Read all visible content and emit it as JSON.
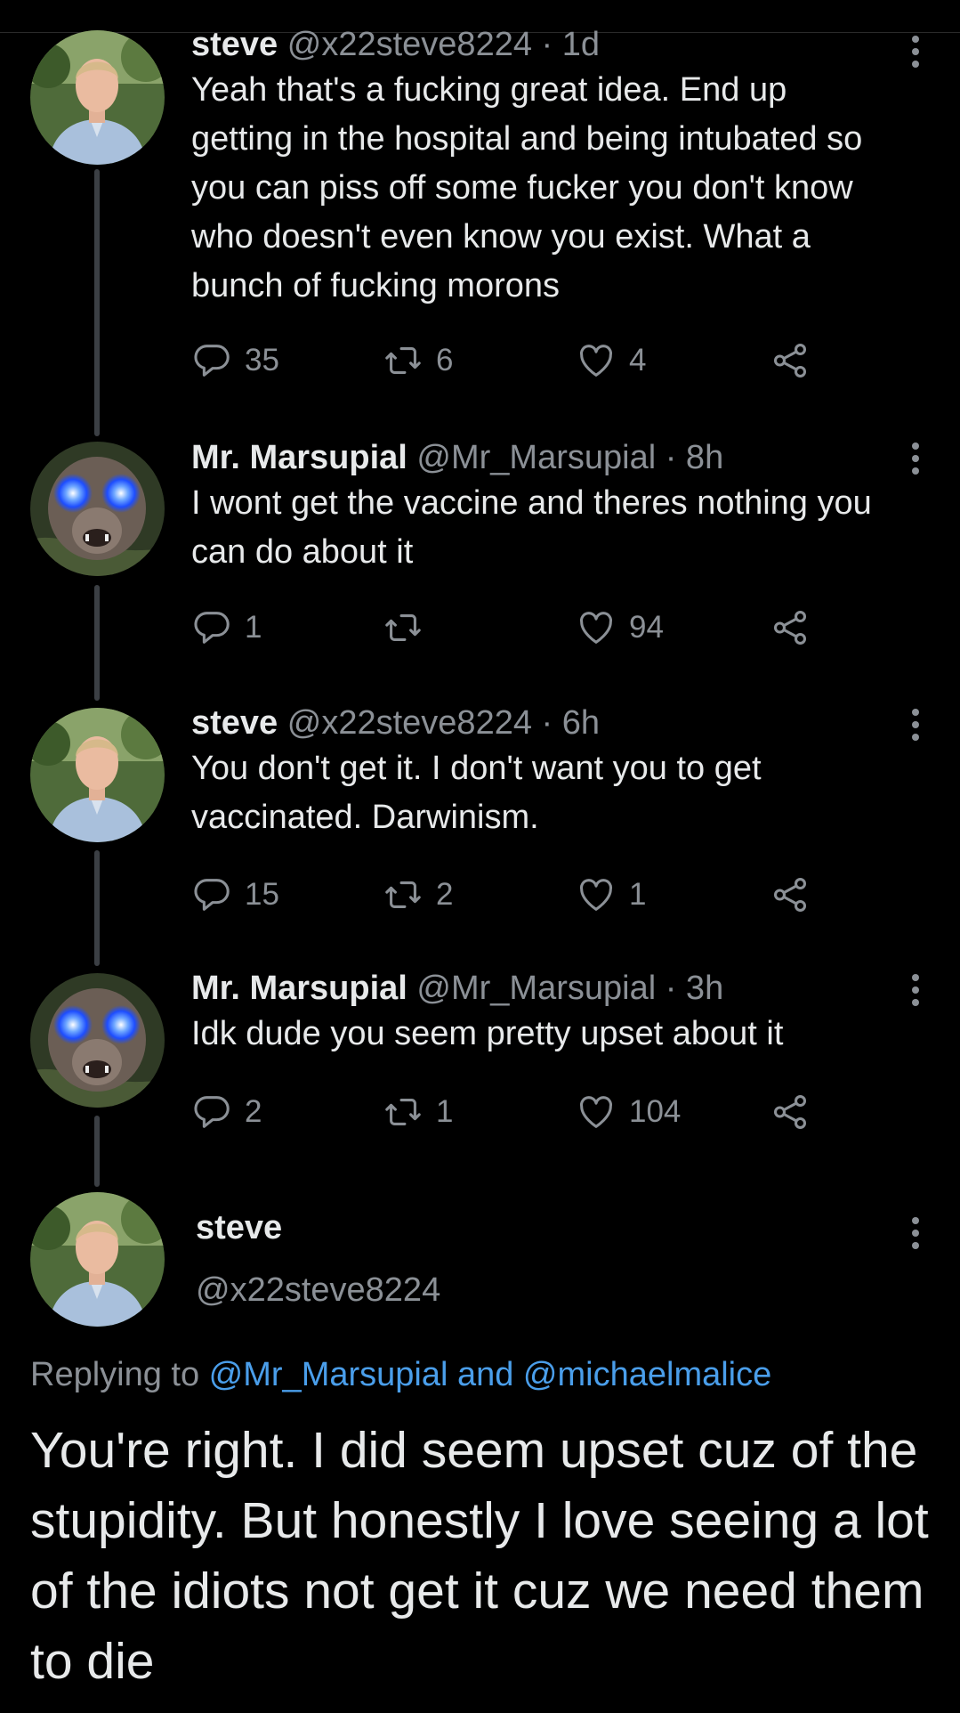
{
  "tweets": [
    {
      "name": "steve",
      "handle": "@x22steve8224",
      "time": "· 1d",
      "text": "Yeah that's a fucking great idea. End up getting in the hospital and being intubated so you can piss off some fucker you don't know who doesn't even know you exist. What a bunch of fucking morons",
      "replies": "35",
      "retweets": "6",
      "likes": "4",
      "avatar": "man-photo"
    },
    {
      "name": "Mr. Marsupial",
      "handle": "@Mr_Marsupial",
      "time": "· 8h",
      "text": "I wont get the vaccine and theres nothing you can do about it",
      "replies": "1",
      "retweets": "",
      "likes": "94",
      "avatar": "possum-glowing-eyes"
    },
    {
      "name": "steve",
      "handle": "@x22steve8224",
      "time": "· 6h",
      "text": "You don't get it. I don't want you to get vaccinated. Darwinism.",
      "replies": "15",
      "retweets": "2",
      "likes": "1",
      "avatar": "man-photo"
    },
    {
      "name": "Mr. Marsupial",
      "handle": "@Mr_Marsupial",
      "time": "· 3h",
      "text": "Idk dude you seem pretty upset about it",
      "replies": "2",
      "retweets": "1",
      "likes": "104",
      "avatar": "possum-glowing-eyes"
    }
  ],
  "focus": {
    "name": "steve",
    "handle": "@x22steve8224",
    "replying_prefix": "Replying to ",
    "replying_to": "@Mr_Marsupial and @michaelmalice",
    "text": "You're right. I did seem upset cuz of the stupidity. But honestly I love seeing a lot of the idiots not get it cuz we need them to die"
  },
  "colors": {
    "background": "#000000",
    "text": "#e7e9ea",
    "muted": "#8b9096",
    "link": "#4a9eea",
    "thread_line": "#3b3f44"
  },
  "icons": [
    "reply-icon",
    "retweet-icon",
    "like-icon",
    "share-icon",
    "more-options-icon"
  ]
}
